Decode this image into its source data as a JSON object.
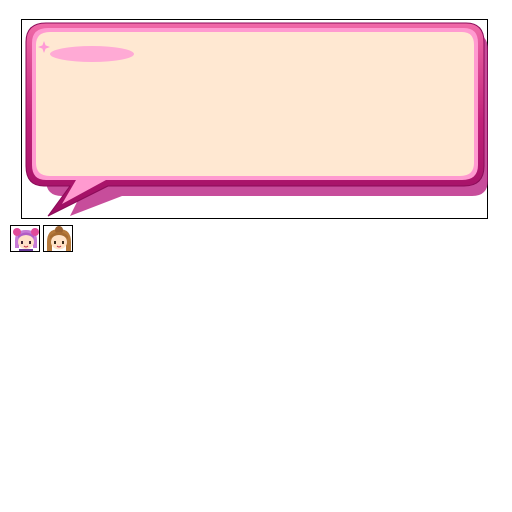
{
  "speech_bubble": {
    "fill_color": "#ffe8d2",
    "border_color": "#c2227a",
    "shadow_color": "#b4127a",
    "sparkle_icon": "sparkle-icon",
    "highlight_color": "#ff9ad6"
  },
  "portraits": [
    {
      "icon": "pink-haired-girl-portrait-icon",
      "hair_color": "#c77ad6",
      "bow_color": "#e04a9a"
    },
    {
      "icon": "brown-haired-girl-portrait-icon",
      "hair_color": "#b5793b"
    }
  ]
}
